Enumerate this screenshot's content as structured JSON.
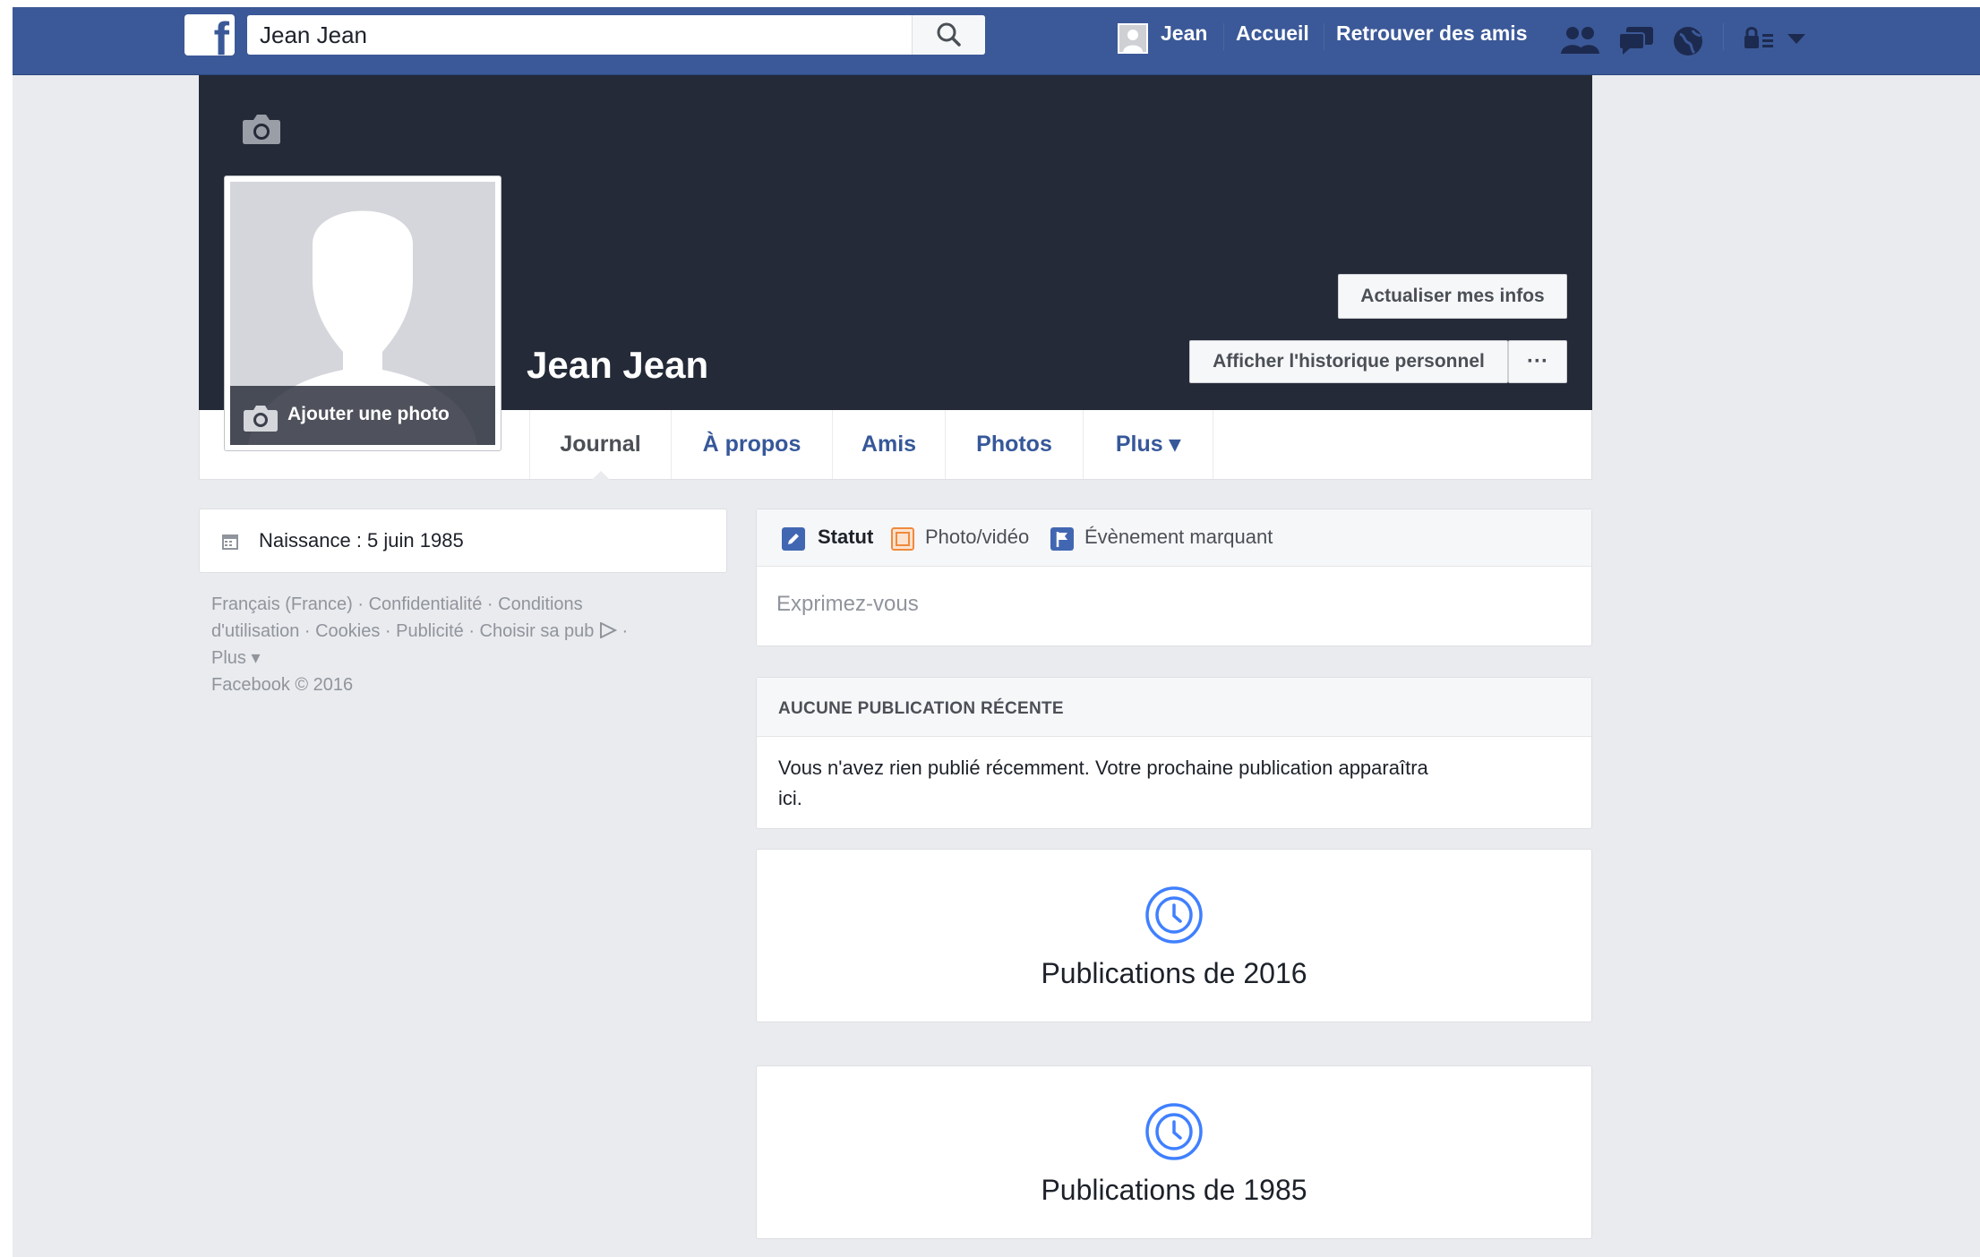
{
  "header": {
    "search_value": "Jean Jean",
    "user_name": "Jean",
    "nav_home": "Accueil",
    "nav_find_friends": "Retrouver des amis"
  },
  "profile": {
    "name": "Jean Jean",
    "add_photo_label": "Ajouter une photo",
    "update_info_label": "Actualiser mes infos",
    "activity_log_label": "Afficher l'historique personnel",
    "more_dots_label": "···"
  },
  "tabs": [
    {
      "label": "Journal"
    },
    {
      "label": "À propos"
    },
    {
      "label": "Amis"
    },
    {
      "label": "Photos"
    },
    {
      "label": "Plus ▾"
    }
  ],
  "intro": {
    "birthday": "Naissance : 5 juin 1985"
  },
  "footer": {
    "line1_a": "Français (France)",
    "line1_b": "Confidentialité",
    "line1_c": "Conditions",
    "line2_a": "d'utilisation",
    "line2_b": "Cookies",
    "line2_c": "Publicité",
    "line2_d": "Choisir sa pub",
    "line3": "Plus ▾",
    "copyright": "Facebook © 2016"
  },
  "composer": {
    "status": "Statut",
    "photo_video": "Photo/vidéo",
    "life_event": "Évènement marquant",
    "placeholder": "Exprimez-vous"
  },
  "no_recent": {
    "title": "AUCUNE PUBLICATION RÉCENTE",
    "text_line1": "Vous n'avez rien publié récemment. Votre prochaine publication apparaîtra",
    "text_line2": "ici."
  },
  "periods": [
    {
      "label": "Publications de 2016"
    },
    {
      "label": "Publications de 1985"
    }
  ],
  "colors": {
    "brand": "#3b5998",
    "cover": "#252a38",
    "link": "#365899",
    "accent_blue": "#4080ff"
  }
}
